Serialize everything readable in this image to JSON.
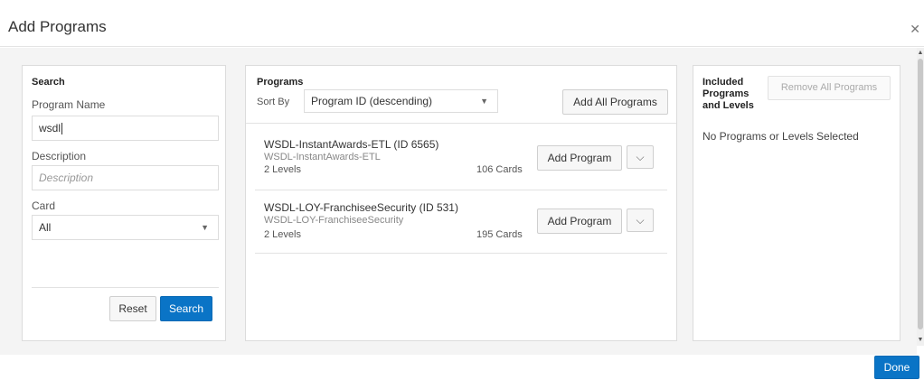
{
  "dialog": {
    "title": "Add Programs",
    "close_icon": "close-icon"
  },
  "search": {
    "heading": "Search",
    "program_name_label": "Program Name",
    "program_name_value": "wsdl",
    "description_label": "Description",
    "description_placeholder": "Description",
    "card_label": "Card",
    "card_value": "All",
    "reset_label": "Reset",
    "search_label": "Search"
  },
  "programs": {
    "heading": "Programs",
    "sort_label": "Sort By",
    "sort_value": "Program ID (descending)",
    "add_all_label": "Add All Programs",
    "items": [
      {
        "name": "WSDL-InstantAwards-ETL (ID 6565)",
        "sub": "WSDL-InstantAwards-ETL",
        "levels": "2 Levels",
        "cards": "106 Cards",
        "add_label": "Add Program"
      },
      {
        "name": "WSDL-LOY-FranchiseeSecurity (ID 531)",
        "sub": "WSDL-LOY-FranchiseeSecurity",
        "levels": "2 Levels",
        "cards": "195 Cards",
        "add_label": "Add Program"
      }
    ]
  },
  "included": {
    "heading_line1": "Included",
    "heading_line2": "Programs",
    "heading_line3": "and Levels",
    "remove_all_label": "Remove All Programs",
    "empty_text": "No Programs or Levels Selected"
  },
  "footer": {
    "done_label": "Done"
  },
  "colors": {
    "primary": "#0a74c6",
    "panel_bg": "#f4f4f4"
  }
}
